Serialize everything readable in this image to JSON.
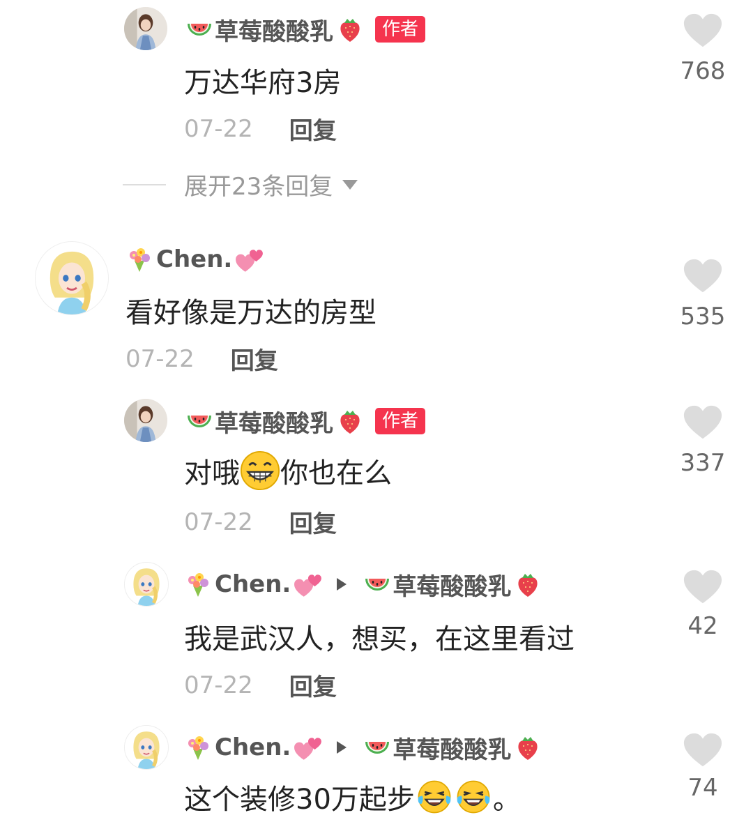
{
  "comments": [
    {
      "author": "草莓酸酸乳",
      "author_badge": "作者",
      "text": "万达华府3房",
      "date": "07-22",
      "reply_label": "回复",
      "likes": "768"
    },
    {
      "author": "Chen.",
      "text": "看好像是万达的房型",
      "date": "07-22",
      "reply_label": "回复",
      "likes": "535"
    },
    {
      "author": "草莓酸酸乳",
      "author_badge": "作者",
      "text_before_emoji": "对哦",
      "text_after_emoji": "你也在么",
      "date": "07-22",
      "reply_label": "回复",
      "likes": "337"
    },
    {
      "author": "Chen.",
      "reply_to": "草莓酸酸乳",
      "text": "我是武汉人，想买，在这里看过",
      "date": "07-22",
      "reply_label": "回复",
      "likes": "42"
    },
    {
      "author": "Chen.",
      "reply_to": "草莓酸酸乳",
      "text_before_emoji": "这个装修30万起步",
      "text_after_emoji": "。",
      "likes": "74"
    }
  ],
  "expand_replies": "展开23条回复",
  "icons": {
    "like": "heart-icon",
    "watermelon": "watermelon-icon",
    "strawberry": "strawberry-icon",
    "bouquet": "bouquet-icon",
    "hearts": "two-hearts-icon",
    "grin": "grin-emoji",
    "laugh_cry": "laugh-cry-emoji"
  },
  "colors": {
    "author_badge": "#f5344e",
    "heart": "#dcdcdc",
    "date": "#b4b4b4"
  }
}
